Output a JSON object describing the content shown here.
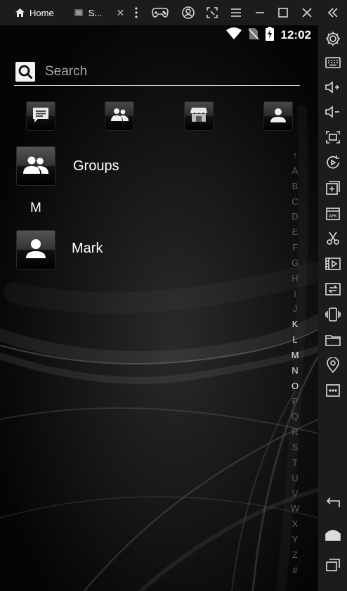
{
  "titlebar": {
    "tabs": [
      {
        "label": "Home",
        "icon": "home-icon"
      },
      {
        "label": "S...",
        "icon": "app-icon",
        "close": "✕"
      }
    ],
    "controls": [
      "more-vertical-icon",
      "gamepad-icon",
      "account-icon",
      "screenshot-icon",
      "menu-icon",
      "minimize-icon",
      "maximize-icon",
      "close-icon",
      "collapse-icon"
    ]
  },
  "statusbar": {
    "time": "12:02",
    "icons": [
      "wifi-icon",
      "no-sim-icon",
      "battery-charging-icon"
    ]
  },
  "search": {
    "placeholder": "Search"
  },
  "toolbar": {
    "buttons": [
      "message-icon",
      "groups-icon",
      "store-icon",
      "contact-icon"
    ]
  },
  "contacts": {
    "groups_label": "Groups",
    "section_header": "M",
    "items": [
      {
        "name": "Mark"
      }
    ]
  },
  "alphabet": [
    "↑",
    "A",
    "B",
    "C",
    "D",
    "E",
    "F",
    "G",
    "H",
    "I",
    "J",
    "K",
    "L",
    "M",
    "N",
    "O",
    "P",
    "Q",
    "R",
    "S",
    "T",
    "U",
    "V",
    "W",
    "X",
    "Y",
    "Z",
    "#"
  ],
  "alphabet_active": [
    "K",
    "L",
    "M",
    "N",
    "O"
  ],
  "sidebar": {
    "buttons": [
      "settings-icon",
      "keyboard-icon",
      "volume-up-icon",
      "volume-down-icon",
      "fullscreen-icon",
      "rotate-icon",
      "add-app-icon",
      "apk-icon",
      "scissors-icon",
      "video-icon",
      "sync-icon",
      "shake-icon",
      "folder-icon",
      "location-icon",
      "more-icon",
      "back-icon",
      "home-icon",
      "recents-icon"
    ]
  },
  "colors": {
    "background": "#000000",
    "chrome": "#1c1c1c",
    "text": "#ffffff",
    "alpha_inactive": "#5c5c5c"
  }
}
